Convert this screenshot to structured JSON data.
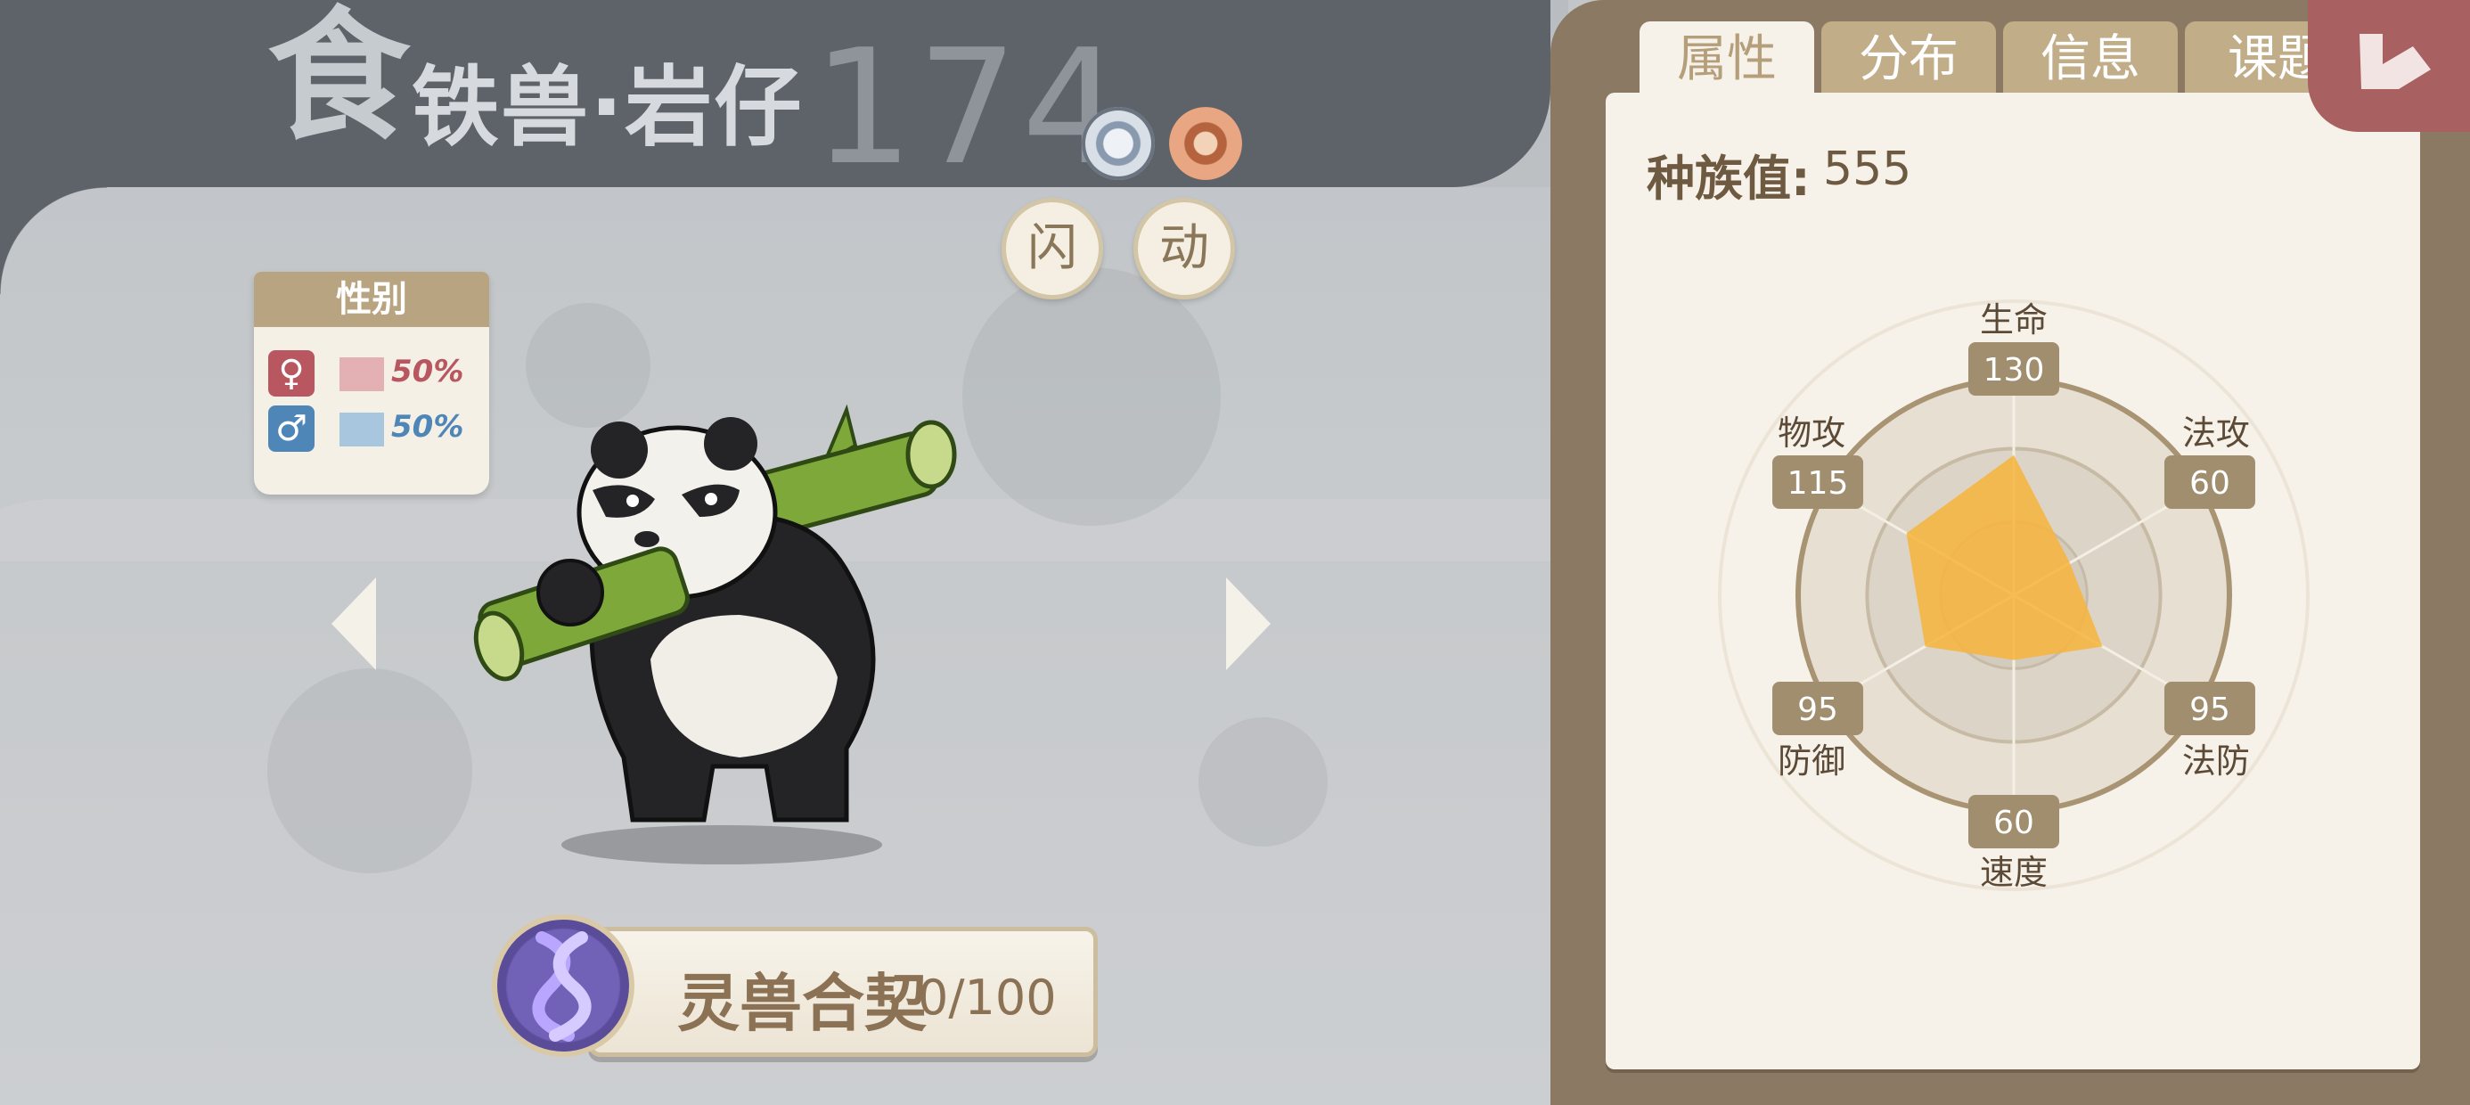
{
  "pet": {
    "type_glyph": "食",
    "name": "铁兽·岩仔",
    "number": "174",
    "element_icons": [
      "light-element-icon",
      "earth-element-icon"
    ],
    "traits": [
      "闪",
      "动"
    ]
  },
  "gender": {
    "title": "性别",
    "female_symbol": "♀",
    "male_symbol": "♂",
    "female_pct": "50%",
    "male_pct": "50%",
    "female_color": "#b8575f",
    "male_color": "#4f86b8"
  },
  "contract": {
    "label": "灵兽合契",
    "count": "0/100",
    "progress": 0
  },
  "tabs": [
    "属性",
    "分布",
    "信息",
    "课题"
  ],
  "active_tab": "属性",
  "race_value": {
    "label": "种族值:",
    "value": "555"
  },
  "chart_data": {
    "type": "radar",
    "axes": [
      "生命",
      "法攻",
      "法防",
      "速度",
      "防御",
      "物攻"
    ],
    "values": [
      130,
      60,
      95,
      60,
      95,
      115
    ],
    "value_labels": [
      "130",
      "60",
      "95",
      "60",
      "95",
      "115"
    ],
    "range": [
      0,
      200
    ],
    "fill_color": "#f7b43c",
    "ring_color": "#a89472"
  }
}
